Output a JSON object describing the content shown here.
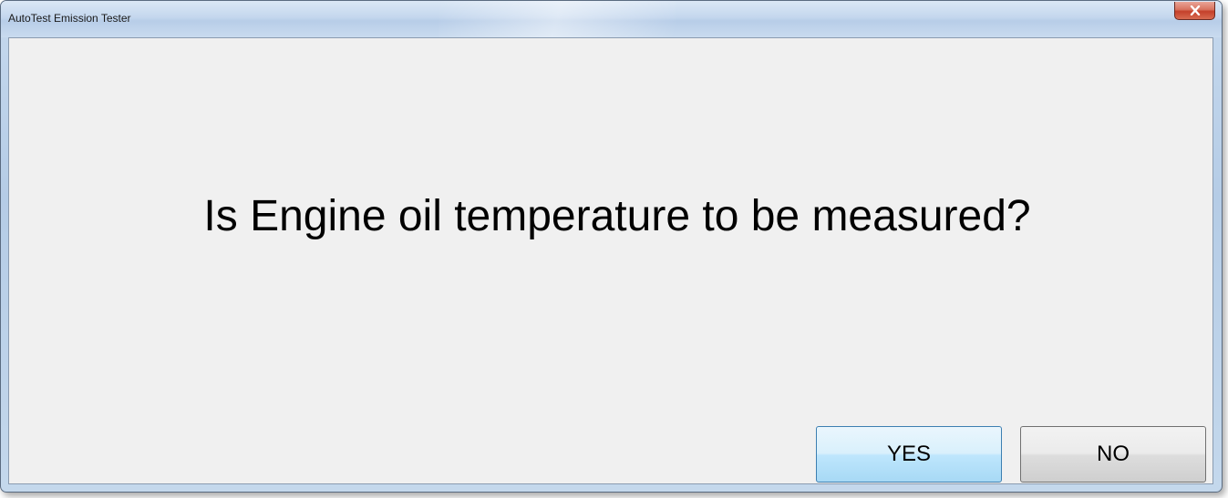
{
  "window": {
    "title": "AutoTest Emission Tester",
    "close_icon": "close-x-icon"
  },
  "dialog": {
    "question": "Is Engine oil temperature to be measured?",
    "yes_label": "YES",
    "no_label": "NO"
  },
  "colors": {
    "client_background": "#f0f0f0",
    "close_button": "#c4402a",
    "focused_button_border": "#3c7fb1"
  }
}
